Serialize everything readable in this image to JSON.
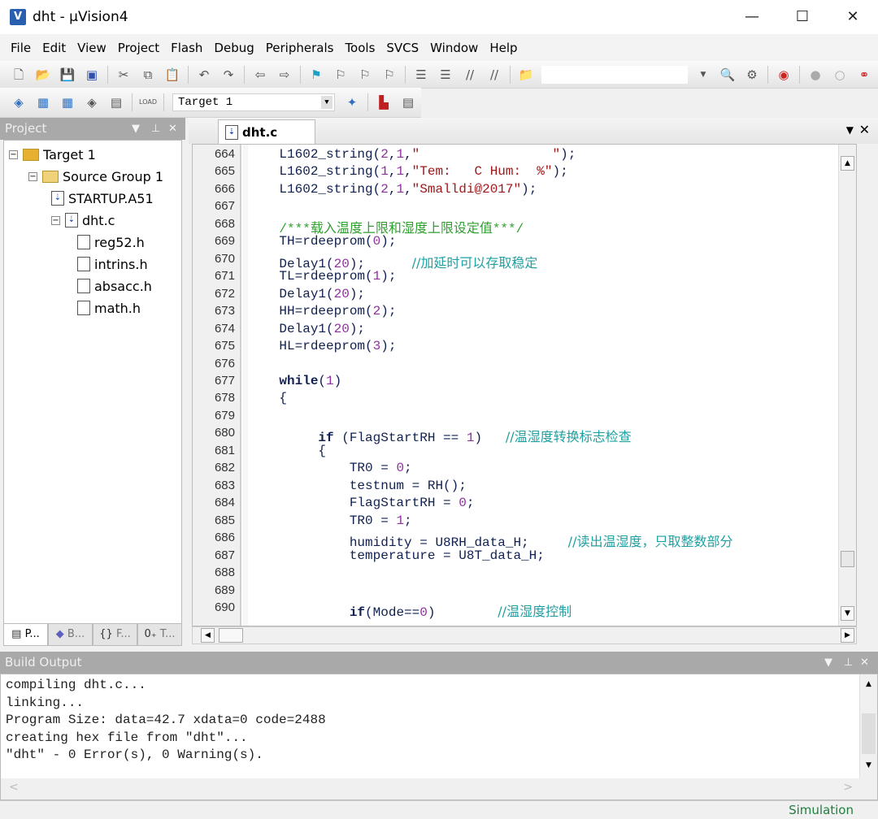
{
  "window": {
    "title": "dht  - µVision4",
    "app_icon": "uvision-logo-icon"
  },
  "menu": [
    "File",
    "Edit",
    "View",
    "Project",
    "Flash",
    "Debug",
    "Peripherals",
    "Tools",
    "SVCS",
    "Window",
    "Help"
  ],
  "toolbar2": {
    "target": "Target 1"
  },
  "project": {
    "title": "Project",
    "tree": [
      {
        "label": "Target 1",
        "level": 0,
        "type": "target"
      },
      {
        "label": "Source Group 1",
        "level": 1,
        "type": "folder"
      },
      {
        "label": "STARTUP.A51",
        "level": 2,
        "type": "file"
      },
      {
        "label": "dht.c",
        "level": 2,
        "type": "file"
      },
      {
        "label": "reg52.h",
        "level": 3,
        "type": "header"
      },
      {
        "label": "intrins.h",
        "level": 3,
        "type": "header"
      },
      {
        "label": "absacc.h",
        "level": 3,
        "type": "header"
      },
      {
        "label": "math.h",
        "level": 3,
        "type": "header"
      }
    ],
    "tabs": [
      "P...",
      "B...",
      "F...",
      "T..."
    ]
  },
  "editor": {
    "tab": "dht.c",
    "lines": [
      {
        "n": "664",
        "t": [
          [
            "p",
            "    L1602_string("
          ],
          [
            "n",
            "2"
          ],
          [
            "p",
            ","
          ],
          [
            "n",
            "1"
          ],
          [
            "p",
            ","
          ],
          [
            "s",
            "\"                 \""
          ],
          [
            "p",
            ");"
          ]
        ]
      },
      {
        "n": "665",
        "t": [
          [
            "p",
            "    L1602_string("
          ],
          [
            "n",
            "1"
          ],
          [
            "p",
            ","
          ],
          [
            "n",
            "1"
          ],
          [
            "p",
            ","
          ],
          [
            "s",
            "\"Tem:   C Hum:  %\""
          ],
          [
            "p",
            ");"
          ]
        ]
      },
      {
        "n": "666",
        "t": [
          [
            "p",
            "    L1602_string("
          ],
          [
            "n",
            "2"
          ],
          [
            "p",
            ","
          ],
          [
            "n",
            "1"
          ],
          [
            "p",
            ","
          ],
          [
            "s",
            "\"Smalldi@2017\""
          ],
          [
            "p",
            ");"
          ]
        ]
      },
      {
        "n": "667",
        "t": []
      },
      {
        "n": "668",
        "t": [
          [
            "p",
            "    "
          ],
          [
            "cg",
            "/***载入温度上限和湿度上限设定值***/"
          ]
        ]
      },
      {
        "n": "669",
        "t": [
          [
            "p",
            "    TH=rdeeprom("
          ],
          [
            "n",
            "0"
          ],
          [
            "p",
            ");"
          ]
        ]
      },
      {
        "n": "670",
        "t": [
          [
            "p",
            "    Delay1("
          ],
          [
            "n",
            "20"
          ],
          [
            "p",
            ");      "
          ],
          [
            "c",
            "//加延时可以存取稳定"
          ]
        ]
      },
      {
        "n": "671",
        "t": [
          [
            "p",
            "    TL=rdeeprom("
          ],
          [
            "n",
            "1"
          ],
          [
            "p",
            ");"
          ]
        ]
      },
      {
        "n": "672",
        "t": [
          [
            "p",
            "    Delay1("
          ],
          [
            "n",
            "20"
          ],
          [
            "p",
            ");"
          ]
        ]
      },
      {
        "n": "673",
        "t": [
          [
            "p",
            "    HH=rdeeprom("
          ],
          [
            "n",
            "2"
          ],
          [
            "p",
            ");"
          ]
        ]
      },
      {
        "n": "674",
        "t": [
          [
            "p",
            "    Delay1("
          ],
          [
            "n",
            "20"
          ],
          [
            "p",
            ");"
          ]
        ]
      },
      {
        "n": "675",
        "t": [
          [
            "p",
            "    HL=rdeeprom("
          ],
          [
            "n",
            "3"
          ],
          [
            "p",
            ");"
          ]
        ]
      },
      {
        "n": "676",
        "t": []
      },
      {
        "n": "677",
        "t": [
          [
            "p",
            "    "
          ],
          [
            "k",
            "while"
          ],
          [
            "p",
            "("
          ],
          [
            "n",
            "1"
          ],
          [
            "p",
            ")"
          ]
        ]
      },
      {
        "n": "678",
        "t": [
          [
            "p",
            "    {"
          ]
        ]
      },
      {
        "n": "679",
        "t": []
      },
      {
        "n": "680",
        "t": [
          [
            "p",
            "         "
          ],
          [
            "k",
            "if"
          ],
          [
            "p",
            " (FlagStartRH == "
          ],
          [
            "n",
            "1"
          ],
          [
            "p",
            ")   "
          ],
          [
            "c",
            "//温湿度转换标志检查"
          ]
        ]
      },
      {
        "n": "681",
        "t": [
          [
            "p",
            "         {"
          ]
        ]
      },
      {
        "n": "682",
        "t": [
          [
            "p",
            "             TR0 = "
          ],
          [
            "n",
            "0"
          ],
          [
            "p",
            ";"
          ]
        ]
      },
      {
        "n": "683",
        "t": [
          [
            "p",
            "             testnum = RH();"
          ]
        ]
      },
      {
        "n": "684",
        "t": [
          [
            "p",
            "             FlagStartRH = "
          ],
          [
            "n",
            "0"
          ],
          [
            "p",
            ";"
          ]
        ]
      },
      {
        "n": "685",
        "t": [
          [
            "p",
            "             TR0 = "
          ],
          [
            "n",
            "1"
          ],
          [
            "p",
            ";"
          ]
        ]
      },
      {
        "n": "686",
        "t": [
          [
            "p",
            "             humidity = U8RH_data_H;     "
          ],
          [
            "c",
            "//读出温湿度，只取整数部分"
          ]
        ]
      },
      {
        "n": "687",
        "t": [
          [
            "p",
            "             temperature = U8T_data_H;"
          ]
        ]
      },
      {
        "n": "688",
        "t": []
      },
      {
        "n": "689",
        "t": []
      },
      {
        "n": "690",
        "t": [
          [
            "p",
            "             "
          ],
          [
            "k",
            "if"
          ],
          [
            "p",
            "(Mode=="
          ],
          [
            "n",
            "0"
          ],
          [
            "p",
            ")        "
          ],
          [
            "c",
            "//温湿度控制"
          ]
        ]
      }
    ]
  },
  "build": {
    "title": "Build Output",
    "lines": [
      "compiling dht.c...",
      "linking...",
      "Program Size: data=42.7 xdata=0 code=2488",
      "creating hex file from \"dht\"...",
      "\"dht\" - 0 Error(s), 0 Warning(s)."
    ]
  },
  "status": {
    "mode": "Simulation"
  }
}
